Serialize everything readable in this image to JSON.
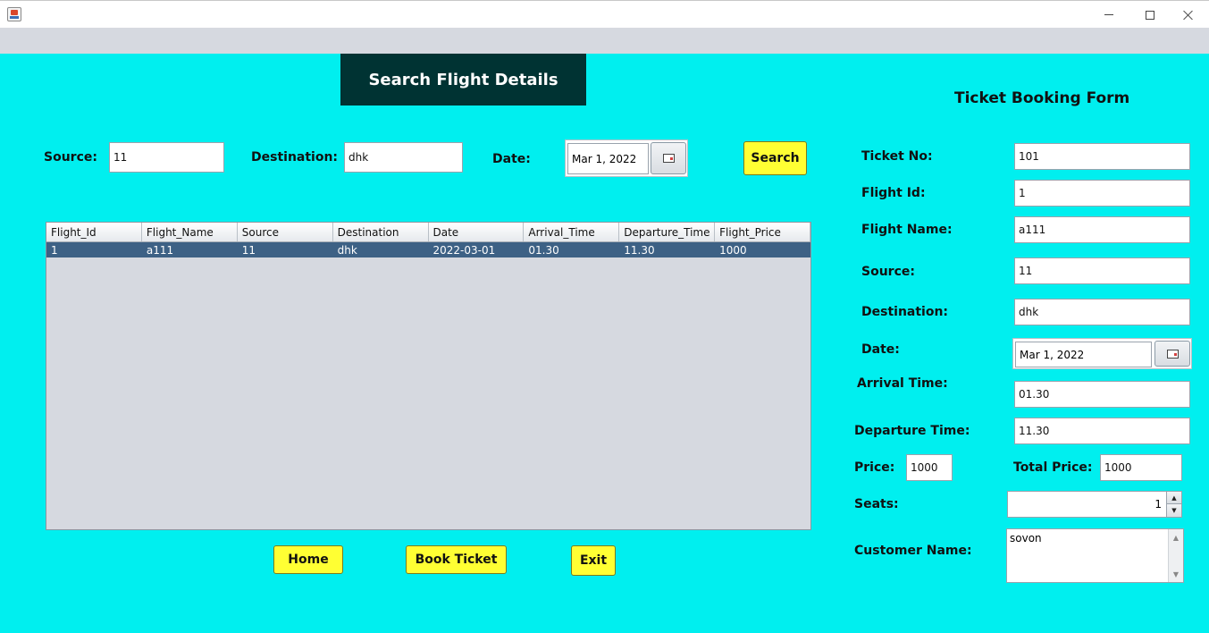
{
  "window": {
    "minimize_glyph": "minimize-icon",
    "maximize_glyph": "maximize-icon",
    "close_glyph": "close-icon"
  },
  "search": {
    "banner_title": "Search Flight Details",
    "source_label": "Source:",
    "source_value": "11",
    "destination_label": "Destination:",
    "destination_value": "dhk",
    "date_label": "Date:",
    "date_value": "Mar 1, 2022",
    "search_button": "Search"
  },
  "table": {
    "columns": [
      "Flight_Id",
      "Flight_Name",
      "Source",
      "Destination",
      "Date",
      "Arrival_Time",
      "Departure_Time",
      "Flight_Price"
    ],
    "rows": [
      [
        "1",
        "a111",
        "11",
        "dhk",
        "2022-03-01",
        "01.30",
        "11.30",
        "1000"
      ]
    ]
  },
  "actions": {
    "home": "Home",
    "book_ticket": "Book Ticket",
    "exit": "Exit"
  },
  "booking": {
    "title": "Ticket Booking Form",
    "ticket_no_label": "Ticket No:",
    "ticket_no_value": "101",
    "flight_id_label": "Flight Id:",
    "flight_id_value": "1",
    "flight_name_label": "Flight Name:",
    "flight_name_value": "a111",
    "source_label": "Source:",
    "source_value": "11",
    "destination_label": "Destination:",
    "destination_value": "dhk",
    "date_label": "Date:",
    "date_value": "Mar 1, 2022",
    "arrival_label": "Arrival Time:",
    "arrival_value": "01.30",
    "departure_label": "Departure Time:",
    "departure_value": "11.30",
    "price_label": "Price:",
    "price_value": "1000",
    "total_price_label": "Total Price:",
    "total_price_value": "1000",
    "seats_label": "Seats:",
    "seats_value": "1",
    "customer_label": "Customer Name:",
    "customer_value": "sovon"
  },
  "colors": {
    "background": "#00efef",
    "banner": "#003333",
    "button": "#ffff33",
    "selected_row": "#3d6185"
  }
}
